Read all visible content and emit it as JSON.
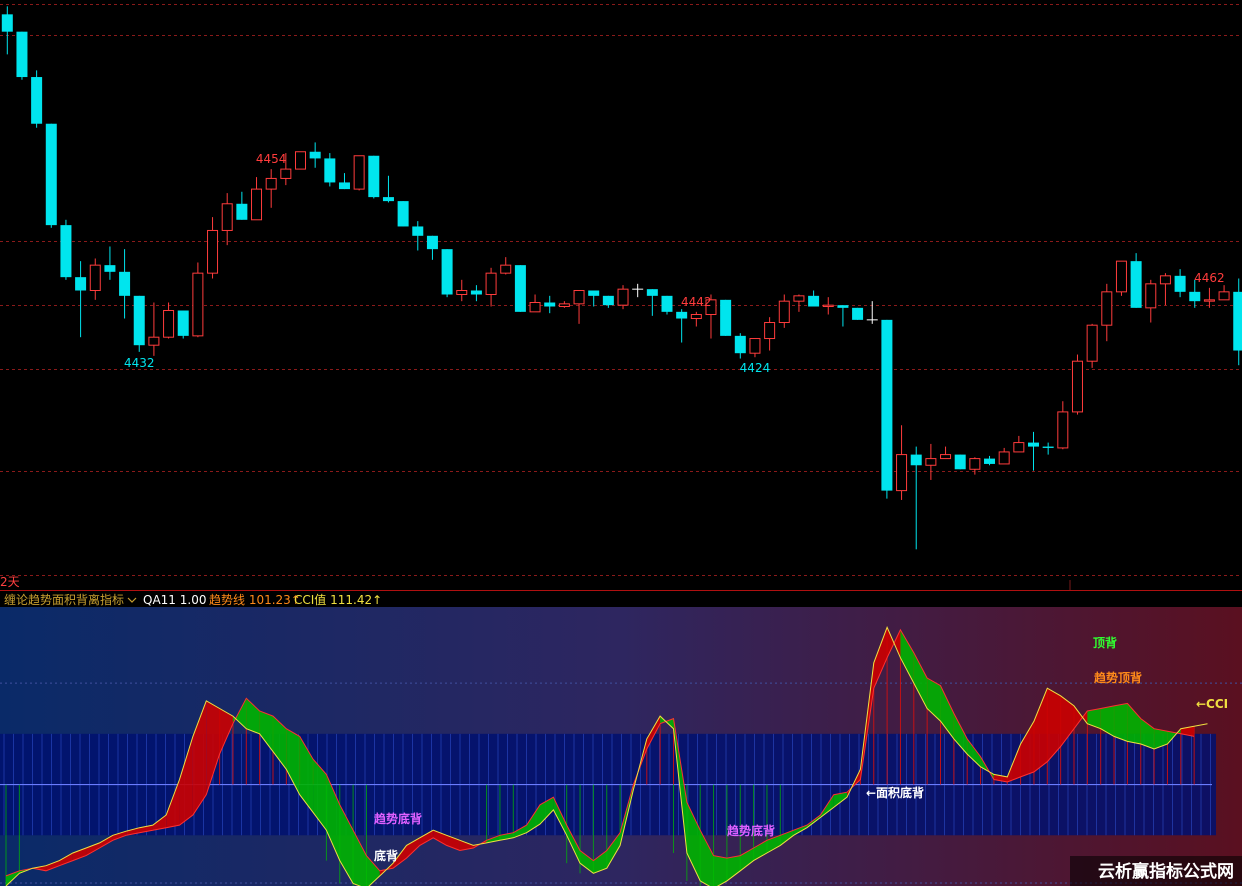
{
  "chart_data": [
    {
      "type": "candlestick",
      "panel": "price",
      "period_label": "2天",
      "price_range": [
        4422.1,
        4465.2
      ],
      "grid": true,
      "high_low_labels": [
        {
          "text": "4454",
          "candle_index": 18,
          "kind": "high"
        },
        {
          "text": "4432",
          "candle_index": 9,
          "kind": "low"
        },
        {
          "text": "4442",
          "candle_index": 47,
          "kind": "high"
        },
        {
          "text": "4424",
          "candle_index": 51,
          "kind": "low"
        },
        {
          "text": "4462",
          "candle_index": 82,
          "kind": "high"
        }
      ],
      "candles": [
        [
          4464.5,
          4465.1,
          4461.5,
          4463.2
        ],
        [
          4463.2,
          4463.2,
          4459.6,
          4459.8
        ],
        [
          4459.8,
          4460.3,
          4456.0,
          4456.3
        ],
        [
          4456.3,
          4456.3,
          4448.5,
          4448.7
        ],
        [
          4448.7,
          4449.1,
          4444.6,
          4444.8
        ],
        [
          4444.8,
          4446.0,
          4440.3,
          4443.8
        ],
        [
          4443.8,
          4446.2,
          4443.1,
          4445.7
        ],
        [
          4445.7,
          4447.1,
          4444.6,
          4445.2
        ],
        [
          4445.2,
          4446.9,
          4441.7,
          4443.4
        ],
        [
          4443.4,
          4443.4,
          4439.2,
          4439.7
        ],
        [
          4439.7,
          4442.9,
          4438.9,
          4440.3
        ],
        [
          4440.3,
          4442.9,
          4440.2,
          4442.3
        ],
        [
          4442.3,
          4442.3,
          4440.2,
          4440.4
        ],
        [
          4440.4,
          4445.9,
          4440.3,
          4445.1
        ],
        [
          4445.1,
          4449.3,
          4444.7,
          4448.3
        ],
        [
          4448.3,
          4451.1,
          4447.2,
          4450.3
        ],
        [
          4450.3,
          4451.2,
          4449.2,
          4449.1
        ],
        [
          4449.1,
          4452.3,
          4449.4,
          4451.4
        ],
        [
          4451.4,
          4452.9,
          4450.0,
          4452.2
        ],
        [
          4452.2,
          4454.1,
          4451.7,
          4452.9
        ],
        [
          4452.9,
          4453.8,
          4452.9,
          4454.2
        ],
        [
          4454.2,
          4454.9,
          4453.0,
          4453.7
        ],
        [
          4453.7,
          4454.1,
          4451.6,
          4451.9
        ],
        [
          4451.9,
          4452.6,
          4451.4,
          4451.4
        ],
        [
          4451.4,
          4453.7,
          4451.3,
          4453.9
        ],
        [
          4453.9,
          4453.9,
          4450.7,
          4450.8
        ],
        [
          4450.8,
          4452.4,
          4450.4,
          4450.5
        ],
        [
          4450.5,
          4450.3,
          4448.6,
          4448.6
        ],
        [
          4448.6,
          4449.0,
          4446.8,
          4447.9
        ],
        [
          4447.9,
          4447.9,
          4446.1,
          4446.9
        ],
        [
          4446.9,
          4446.9,
          4443.3,
          4443.5
        ],
        [
          4443.5,
          4444.6,
          4443.0,
          4443.8
        ],
        [
          4443.8,
          4444.2,
          4443.0,
          4443.5
        ],
        [
          4443.5,
          4445.5,
          4442.6,
          4445.1
        ],
        [
          4445.1,
          4446.3,
          4445.0,
          4445.7
        ],
        [
          4445.7,
          4445.7,
          4442.2,
          4442.2
        ],
        [
          4442.2,
          4443.5,
          4442.2,
          4442.9
        ],
        [
          4442.9,
          4443.4,
          4442.1,
          4442.6
        ],
        [
          4442.6,
          4443.0,
          4442.5,
          4442.8
        ],
        [
          4442.8,
          4443.1,
          4441.3,
          4443.8
        ],
        [
          4443.8,
          4443.5,
          4442.6,
          4443.4
        ],
        [
          4443.4,
          4443.2,
          4442.5,
          4442.7
        ],
        [
          4442.7,
          4444.2,
          4442.4,
          4443.9
        ],
        [
          4443.9,
          4444.3,
          4443.3,
          4443.9
        ],
        [
          4443.9,
          4443.7,
          4441.9,
          4443.4
        ],
        [
          4443.4,
          4443.0,
          4442.0,
          4442.2
        ],
        [
          4442.2,
          4442.4,
          4439.9,
          4441.7
        ],
        [
          4441.7,
          4442.2,
          4441.1,
          4442.0
        ],
        [
          4442.0,
          4443.5,
          4440.2,
          4443.1
        ],
        [
          4443.1,
          4443.0,
          4440.5,
          4440.4
        ],
        [
          4440.4,
          4440.6,
          4438.7,
          4439.1
        ],
        [
          4439.1,
          4440.2,
          4438.8,
          4440.2
        ],
        [
          4440.2,
          4441.8,
          4439.3,
          4441.4
        ],
        [
          4441.4,
          4443.5,
          4441.0,
          4443.0
        ],
        [
          4443.0,
          4443.5,
          4442.2,
          4443.4
        ],
        [
          4443.4,
          4443.8,
          4442.6,
          4442.6
        ],
        [
          4442.6,
          4443.3,
          4442.0,
          4442.7
        ],
        [
          4442.7,
          4442.7,
          4441.1,
          4442.5
        ],
        [
          4442.5,
          4442.4,
          4441.7,
          4441.6
        ],
        [
          4441.6,
          4443.0,
          4441.3,
          4441.6
        ],
        [
          4441.6,
          4441.6,
          4428.2,
          4428.8
        ],
        [
          4428.8,
          4433.7,
          4428.1,
          4431.5
        ],
        [
          4431.5,
          4432.1,
          4424.4,
          4430.7
        ],
        [
          4430.7,
          4432.3,
          4429.6,
          4431.2
        ],
        [
          4431.2,
          4432.1,
          4431.3,
          4431.5
        ],
        [
          4431.5,
          4431.5,
          4430.4,
          4430.4
        ],
        [
          4430.4,
          4431.3,
          4430.0,
          4431.2
        ],
        [
          4431.2,
          4431.4,
          4430.7,
          4430.8
        ],
        [
          4430.8,
          4432.0,
          4430.9,
          4431.7
        ],
        [
          4431.7,
          4432.9,
          4431.7,
          4432.4
        ],
        [
          4432.4,
          4433.2,
          4430.3,
          4432.1
        ],
        [
          4432.1,
          4432.4,
          4431.5,
          4432.0
        ],
        [
          4432.0,
          4435.5,
          4431.9,
          4434.7
        ],
        [
          4434.7,
          4439.0,
          4434.5,
          4438.5
        ],
        [
          4438.5,
          4441.3,
          4438.0,
          4441.2
        ],
        [
          4441.2,
          4444.3,
          4440.0,
          4443.7
        ],
        [
          4443.7,
          4445.6,
          4443.4,
          4446.0
        ],
        [
          4446.0,
          4446.6,
          4443.3,
          4442.5
        ],
        [
          4442.5,
          4444.6,
          4441.4,
          4444.3
        ],
        [
          4444.3,
          4445.1,
          4442.7,
          4444.9
        ],
        [
          4444.9,
          4445.4,
          4443.3,
          4443.7
        ],
        [
          4443.7,
          4444.6,
          4442.5,
          4443.0
        ],
        [
          4443.0,
          4444.0,
          4442.5,
          4443.1
        ],
        [
          4443.1,
          4444.2,
          4443.8,
          4443.7
        ],
        [
          4443.7,
          4444.7,
          4438.2,
          4439.3
        ],
        [
          4439.3,
          4448.5,
          4438.6,
          4446.0
        ],
        [
          4446.0,
          4452.0,
          4444.3,
          4450.3
        ],
        [
          4450.3,
          4456.6,
          4448.3,
          4456.6
        ],
        [
          4456.6,
          4456.6,
          4456.2,
          4451.7
        ],
        [
          4451.7,
          4455.3,
          4450.7,
          4453.1
        ],
        [
          4453.1,
          4454.5,
          4452.2,
          4452.6
        ],
        [
          4452.6,
          4454.2,
          4451.7,
          4454.3
        ],
        [
          4454.3,
          4455.3,
          4452.5,
          4454.1
        ],
        [
          4454.1,
          4455.0,
          4452.8,
          4454.5
        ],
        [
          4454.5,
          4462.1,
          4454.8,
          4461.5
        ]
      ]
    },
    {
      "type": "line",
      "panel": "indicator",
      "indicator_name": "缠论趋势面积背离指标",
      "indicator_values": [
        {
          "label": "QA11 1.00",
          "color": "#ffffff"
        },
        {
          "label": "趋势线 101.23↑",
          "color": "#ff8a1a"
        },
        {
          "label": "CCI值 111.42↑",
          "color": "#f0e040"
        }
      ],
      "range": [
        -200,
        350
      ],
      "series": [
        {
          "name": "趋势线",
          "values": [
            -180,
            -170,
            -165,
            -170,
            -160,
            -150,
            -140,
            -125,
            -110,
            -100,
            -95,
            -90,
            -85,
            -80,
            -60,
            -20,
            60,
            120,
            170,
            145,
            135,
            110,
            95,
            50,
            20,
            -40,
            -90,
            -140,
            -170,
            -165,
            -145,
            -120,
            -105,
            -120,
            -130,
            -125,
            -110,
            -100,
            -95,
            -80,
            -40,
            -25,
            -80,
            -130,
            -150,
            -130,
            -95,
            0,
            70,
            120,
            130,
            -35,
            -90,
            -140,
            -145,
            -140,
            -125,
            -110,
            -100,
            -90,
            -80,
            -60,
            -20,
            -15,
            10,
            190,
            250,
            305,
            260,
            210,
            195,
            140,
            90,
            55,
            10,
            5,
            15,
            25,
            45,
            75,
            110,
            145,
            150,
            155,
            160,
            130,
            110,
            105,
            100,
            95
          ]
        },
        {
          "name": "CCI",
          "values": [
            -200,
            -175,
            -165,
            -160,
            -150,
            -135,
            -125,
            -115,
            -100,
            -92,
            -85,
            -80,
            -60,
            10,
            95,
            165,
            150,
            135,
            110,
            100,
            65,
            30,
            -20,
            -55,
            -90,
            -150,
            -195,
            -205,
            -180,
            -155,
            -120,
            -105,
            -90,
            -100,
            -110,
            -120,
            -115,
            -110,
            -105,
            -95,
            -78,
            -50,
            -100,
            -155,
            -175,
            -165,
            -120,
            -10,
            90,
            135,
            110,
            -135,
            -190,
            -205,
            -190,
            -170,
            -150,
            -135,
            -120,
            -100,
            -85,
            -65,
            -45,
            -25,
            30,
            240,
            310,
            250,
            200,
            150,
            125,
            90,
            60,
            35,
            20,
            15,
            80,
            125,
            190,
            175,
            155,
            120,
            110,
            95,
            85,
            80,
            70,
            80,
            110,
            115,
            120
          ]
        }
      ],
      "annotations": [
        {
          "text": "趋势底背",
          "color": "#e060ff"
        },
        {
          "text": "底背",
          "color": "#ffffff"
        },
        {
          "text": "趋势底背",
          "color": "#e060ff"
        },
        {
          "text": "←面积底背",
          "color": "#ffffff"
        },
        {
          "text": "顶背",
          "color": "#30ff30"
        },
        {
          "text": "趋势顶背",
          "color": "#ff8a1a"
        },
        {
          "text": "←CCI",
          "color": "#f0e040"
        }
      ]
    }
  ],
  "watermark": "云析赢指标公式网",
  "colors": {
    "bull": "#ff3c3c",
    "bear": "#00e5ee",
    "doji": "#ffffff",
    "grid": "#8a1a1a",
    "fill_up": "#cc0000",
    "fill_down": "#00b400"
  }
}
